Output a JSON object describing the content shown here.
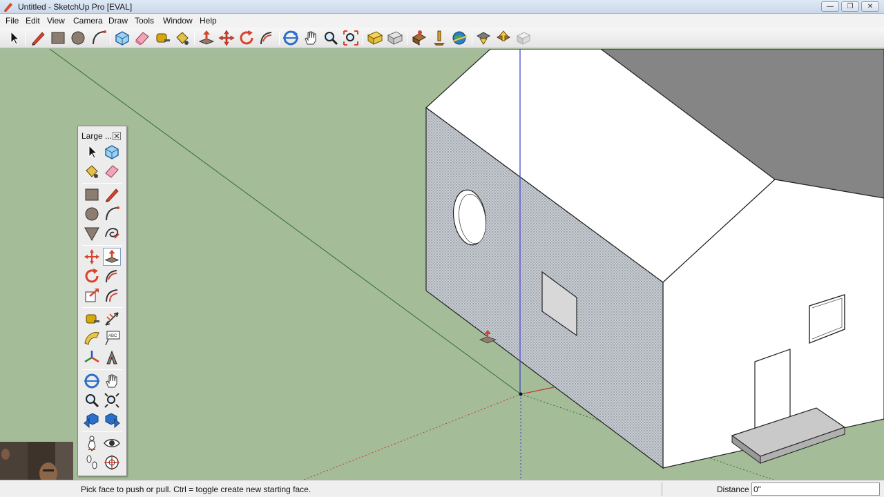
{
  "window": {
    "title": "Untitled - SketchUp Pro [EVAL]",
    "controls": {
      "minimize": "—",
      "maximize": "❐",
      "close": "✕"
    }
  },
  "menu": [
    "File",
    "Edit",
    "View",
    "Camera",
    "Draw",
    "Tools",
    "Window",
    "Help"
  ],
  "toolbar": {
    "buttons": [
      "select-tool",
      "line-tool",
      "rectangle-tool",
      "circle-tool",
      "arc-tool",
      "make-component-tool",
      "eraser-tool",
      "tape-measure-tool",
      "paint-bucket-tool",
      "push-pull-tool",
      "move-tool",
      "rotate-tool",
      "follow-me-tool",
      "orbit-tool",
      "pan-tool",
      "zoom-tool",
      "zoom-extents-tool",
      "get-models-tool",
      "share-model-tool",
      "get-components-tool",
      "add-location-tool",
      "google-earth-tool",
      "preview-in-earth-tool",
      "photo-textures-tool",
      "extension-warehouse-tool"
    ]
  },
  "palette": {
    "title": "Large ...",
    "tools": [
      "select-tool",
      "make-component-tool",
      "paint-bucket-tool",
      "eraser-tool",
      "rectangle-tool",
      "line-tool",
      "circle-tool",
      "arc-tool",
      "polygon-tool",
      "freehand-tool",
      "move-tool",
      "push-pull-tool",
      "rotate-tool",
      "follow-me-tool",
      "scale-tool",
      "offset-tool",
      "tape-measure-tool",
      "dimension-tool",
      "protractor-tool",
      "text-tool",
      "axes-tool",
      "3d-text-tool",
      "orbit-tool",
      "pan-tool",
      "zoom-tool",
      "zoom-window-tool",
      "previous-view-tool",
      "next-view-tool",
      "position-camera-tool",
      "look-around-tool",
      "walk-tool",
      "section-plane-tool"
    ]
  },
  "status": {
    "hint": "Pick face to push or pull.  Ctrl = toggle create new starting face.",
    "measurement_label": "Distance",
    "measurement_value": "0\""
  },
  "colors": {
    "ground": "#a4bc98",
    "wall_white": "#ffffff",
    "roof_dark": "#8a8a8a",
    "selected_face": "#c9cdd2",
    "axis_green": "#2f6f2f",
    "axis_blue": "#3a3ad0",
    "axis_red": "#c0392b"
  }
}
